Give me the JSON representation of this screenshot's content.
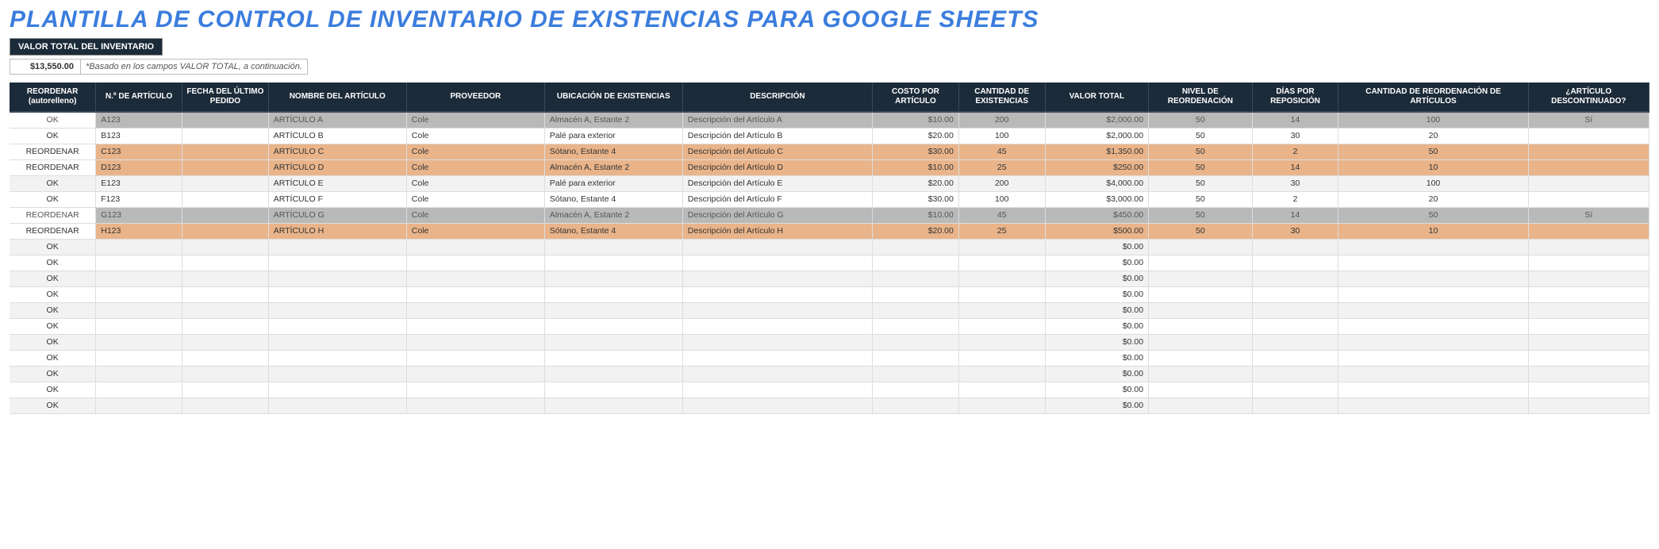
{
  "title": "PLANTILLA DE CONTROL DE INVENTARIO DE EXISTENCIAS PARA GOOGLE SHEETS",
  "summary": {
    "label": "VALOR TOTAL DEL INVENTARIO",
    "value": "$13,550.00",
    "note": "*Basado en los campos VALOR TOTAL, a continuación."
  },
  "headers": {
    "reorder": "REORDENAR (autorelleno)",
    "item_no": "N.º DE ARTÍCULO",
    "last_order": "FECHA DEL ÚLTIMO PEDIDO",
    "name": "NOMBRE DEL ARTÍCULO",
    "vendor": "PROVEEDOR",
    "location": "UBICACIÓN DE EXISTENCIAS",
    "desc": "DESCRIPCIÓN",
    "cost": "COSTO POR ARTÍCULO",
    "qty": "CANTIDAD DE EXISTENCIAS",
    "total": "VALOR TOTAL",
    "rlevel": "NIVEL DE REORDENACIÓN",
    "days": "DÍAS POR REPOSICIÓN",
    "rqty": "CANTIDAD DE REORDENACIÓN DE ARTÍCULOS",
    "disc": "¿ARTÍCULO DESCONTINUADO?"
  },
  "rows": [
    {
      "reorder": "OK",
      "item_no": "A123",
      "name": "ARTÍCULO A",
      "vendor": "Cole",
      "location": "Almacén A, Estante 2",
      "desc": "Descripción del Artículo A",
      "cost": "$10.00",
      "qty": "200",
      "total": "$2,000.00",
      "rlevel": "50",
      "days": "14",
      "rqty": "100",
      "disc": "Sí",
      "state": "disc"
    },
    {
      "reorder": "OK",
      "item_no": "B123",
      "name": "ARTÍCULO B",
      "vendor": "Cole",
      "location": "Palé para exterior",
      "desc": "Descripción del Artículo B",
      "cost": "$20.00",
      "qty": "100",
      "total": "$2,000.00",
      "rlevel": "50",
      "days": "30",
      "rqty": "20",
      "disc": "",
      "state": "odd"
    },
    {
      "reorder": "REORDENAR",
      "item_no": "C123",
      "name": "ARTÍCULO C",
      "vendor": "Cole",
      "location": "Sótano, Estante 4",
      "desc": "Descripción del Artículo C",
      "cost": "$30.00",
      "qty": "45",
      "total": "$1,350.00",
      "rlevel": "50",
      "days": "2",
      "rqty": "50",
      "disc": "",
      "state": "reorder"
    },
    {
      "reorder": "REORDENAR",
      "item_no": "D123",
      "name": "ARTÍCULO D",
      "vendor": "Cole",
      "location": "Almacén A, Estante 2",
      "desc": "Descripción del Artículo D",
      "cost": "$10.00",
      "qty": "25",
      "total": "$250.00",
      "rlevel": "50",
      "days": "14",
      "rqty": "10",
      "disc": "",
      "state": "reorder"
    },
    {
      "reorder": "OK",
      "item_no": "E123",
      "name": "ARTÍCULO E",
      "vendor": "Cole",
      "location": "Palé para exterior",
      "desc": "Descripción del Artículo E",
      "cost": "$20.00",
      "qty": "200",
      "total": "$4,000.00",
      "rlevel": "50",
      "days": "30",
      "rqty": "100",
      "disc": "",
      "state": "even"
    },
    {
      "reorder": "OK",
      "item_no": "F123",
      "name": "ARTÍCULO F",
      "vendor": "Cole",
      "location": "Sótano, Estante 4",
      "desc": "Descripción del Artículo F",
      "cost": "$30.00",
      "qty": "100",
      "total": "$3,000.00",
      "rlevel": "50",
      "days": "2",
      "rqty": "20",
      "disc": "",
      "state": "odd"
    },
    {
      "reorder": "REORDENAR",
      "item_no": "G123",
      "name": "ARTÍCULO G",
      "vendor": "Cole",
      "location": "Almacén A, Estante 2",
      "desc": "Descripción del Artículo G",
      "cost": "$10.00",
      "qty": "45",
      "total": "$450.00",
      "rlevel": "50",
      "days": "14",
      "rqty": "50",
      "disc": "Sí",
      "state": "disc"
    },
    {
      "reorder": "REORDENAR",
      "item_no": "H123",
      "name": "ARTÍCULO H",
      "vendor": "Cole",
      "location": "Sótano, Estante 4",
      "desc": "Descripción del Artículo H",
      "cost": "$20.00",
      "qty": "25",
      "total": "$500.00",
      "rlevel": "50",
      "days": "30",
      "rqty": "10",
      "disc": "",
      "state": "reorder"
    },
    {
      "reorder": "OK",
      "total": "$0.00",
      "state": "even"
    },
    {
      "reorder": "OK",
      "total": "$0.00",
      "state": "odd"
    },
    {
      "reorder": "OK",
      "total": "$0.00",
      "state": "even"
    },
    {
      "reorder": "OK",
      "total": "$0.00",
      "state": "odd"
    },
    {
      "reorder": "OK",
      "total": "$0.00",
      "state": "even"
    },
    {
      "reorder": "OK",
      "total": "$0.00",
      "state": "odd"
    },
    {
      "reorder": "OK",
      "total": "$0.00",
      "state": "even"
    },
    {
      "reorder": "OK",
      "total": "$0.00",
      "state": "odd"
    },
    {
      "reorder": "OK",
      "total": "$0.00",
      "state": "even"
    },
    {
      "reorder": "OK",
      "total": "$0.00",
      "state": "odd"
    },
    {
      "reorder": "OK",
      "total": "$0.00",
      "state": "even"
    }
  ]
}
